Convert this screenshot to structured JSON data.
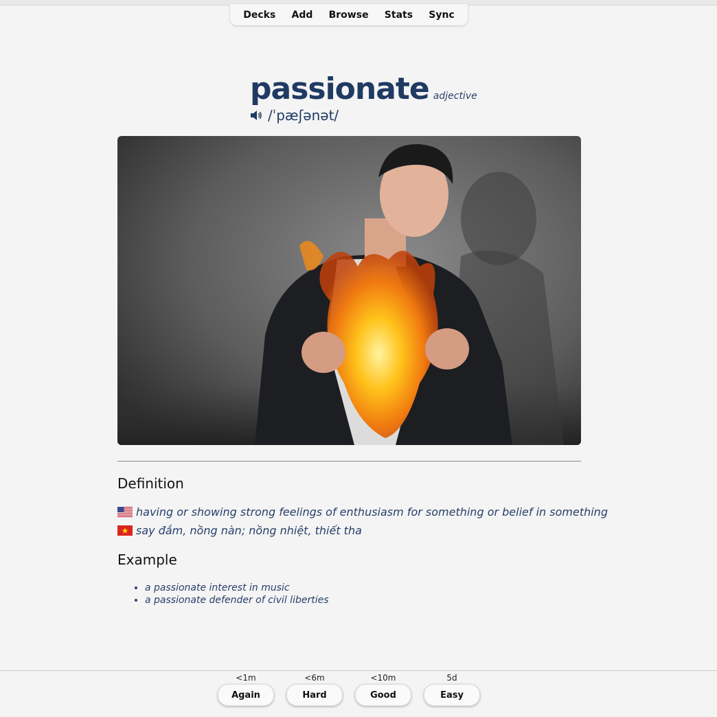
{
  "nav": {
    "items": [
      {
        "label": "Decks"
      },
      {
        "label": "Add"
      },
      {
        "label": "Browse"
      },
      {
        "label": "Stats"
      },
      {
        "label": "Sync"
      }
    ]
  },
  "card": {
    "word": "passionate",
    "part_of_speech": "adjective",
    "pronunciation": "/ˈpæʃənət/",
    "speaker_icon": "speaker-icon",
    "image_description_icon": "man-opening-shirt-with-fire-chest",
    "definition_heading": "Definition",
    "definitions": [
      {
        "flag": "us-flag-icon",
        "text": "having or showing strong feelings of enthusiasm for something or belief in something"
      },
      {
        "flag": "vietnam-flag-icon",
        "text": "say đắm, nồng nàn; nồng nhiệt, thiết tha"
      }
    ],
    "example_heading": "Example",
    "examples": [
      "a passionate interest in music",
      "a passionate defender of civil liberties"
    ]
  },
  "answers": [
    {
      "interval": "<1m",
      "label": "Again"
    },
    {
      "interval": "<6m",
      "label": "Hard"
    },
    {
      "interval": "<10m",
      "label": "Good"
    },
    {
      "interval": "5d",
      "label": "Easy"
    }
  ],
  "colors": {
    "accent": "#1f3a63",
    "background": "#f4f4f4"
  }
}
